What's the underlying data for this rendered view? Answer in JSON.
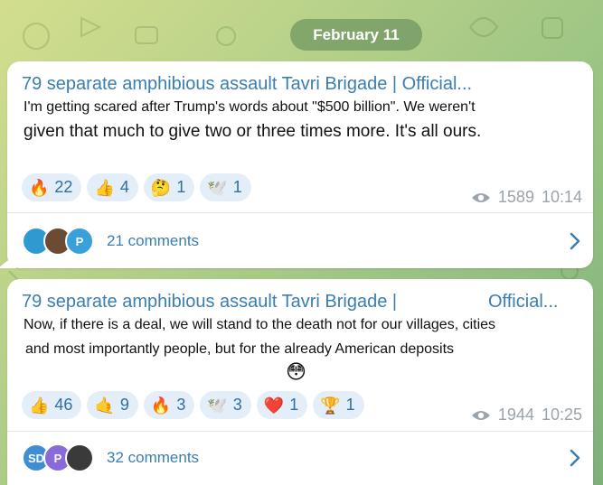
{
  "date_pill": "February 11",
  "posts": [
    {
      "channel": "79 separate amphibious assault Tavri Brigade | Official...",
      "line1": "I'm getting scared after Trump's words about \"$500 billion\". We weren't",
      "line2": "given that much to give two or three times more. It's all ours.",
      "reactions": [
        {
          "emoji": "🔥",
          "count": "22",
          "icon": "fire-icon"
        },
        {
          "emoji": "👍",
          "count": "4",
          "icon": "thumbs-up-icon"
        },
        {
          "emoji": "🤔",
          "count": "1",
          "icon": "thinking-face-icon"
        },
        {
          "emoji": "🕊️",
          "count": "1",
          "icon": "dove-icon"
        }
      ],
      "views": "1589",
      "time": "10:14",
      "avatars": [
        {
          "label": "",
          "color": "#2e9ad0",
          "icon": "avatar-1"
        },
        {
          "label": "",
          "color": "#6b4b33",
          "icon": "avatar-2"
        },
        {
          "label": "P",
          "color": "#3aa0da",
          "icon": "avatar-3"
        }
      ],
      "comments": "21 comments"
    },
    {
      "channel_a": "79 separate amphibious assault Tavri Brigade |",
      "channel_b": "Official...",
      "line1": "Now, if there is a deal, we will stand to the death not for our villages, cities",
      "line2": "and most importantly people, but for the already American deposits",
      "inline_emoji": "😳",
      "reactions": [
        {
          "emoji": "👍",
          "count": "46",
          "icon": "thumbs-up-icon"
        },
        {
          "emoji": "🤙",
          "count": "9",
          "icon": "hand-icon"
        },
        {
          "emoji": "🔥",
          "count": "3",
          "icon": "fire-icon"
        },
        {
          "emoji": "🕊️",
          "count": "3",
          "icon": "dove-icon"
        },
        {
          "emoji": "❤️",
          "count": "1",
          "icon": "heart-icon"
        },
        {
          "emoji": "🏆",
          "count": "1",
          "icon": "trophy-icon"
        }
      ],
      "views": "1944",
      "time": "10:25",
      "avatars": [
        {
          "label": "SD",
          "color": "#3f8fd0",
          "icon": "avatar-1"
        },
        {
          "label": "P",
          "color": "#8a6ad8",
          "icon": "avatar-2"
        },
        {
          "label": "",
          "color": "#3a3a3a",
          "icon": "avatar-3"
        }
      ],
      "comments": "32 comments"
    }
  ]
}
